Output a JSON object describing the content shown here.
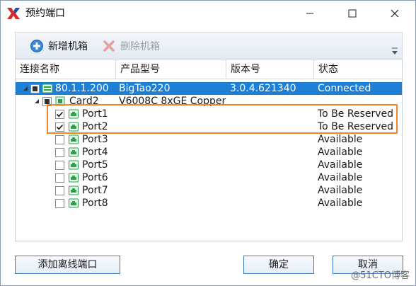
{
  "window": {
    "title": "预约端口"
  },
  "toolbar": {
    "add_label": "新增机箱",
    "delete_label": "删除机箱"
  },
  "grid": {
    "columns": [
      "连接名称",
      "产品型号",
      "版本号",
      "状态"
    ],
    "chassis": {
      "name": "80.1.1.200",
      "model": "BigTao220",
      "version": "3.0.4.621340",
      "status": "Connected"
    },
    "card": {
      "name": "Card2",
      "model": "V6008C 8xGE Copper"
    },
    "ports": [
      {
        "name": "Port1",
        "status": "To Be Reserved",
        "checked": true
      },
      {
        "name": "Port2",
        "status": "To Be Reserved",
        "checked": true
      },
      {
        "name": "Port3",
        "status": "Available",
        "checked": false
      },
      {
        "name": "Port4",
        "status": "Available",
        "checked": false
      },
      {
        "name": "Port5",
        "status": "Available",
        "checked": false
      },
      {
        "name": "Port6",
        "status": "Available",
        "checked": false
      },
      {
        "name": "Port7",
        "status": "Available",
        "checked": false
      },
      {
        "name": "Port8",
        "status": "Available",
        "checked": false
      }
    ]
  },
  "buttons": {
    "offline": "添加离线端口",
    "ok": "确定",
    "cancel": "取消"
  },
  "watermark": "@51CTO博客",
  "colors": {
    "selection": "#1e7fd7",
    "highlight": "#f0872a",
    "button_border": "#3a79c8",
    "port_icon": "#2aa14a"
  }
}
